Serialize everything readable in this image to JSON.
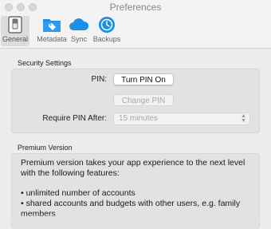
{
  "window": {
    "title": "Preferences"
  },
  "toolbar": {
    "items": [
      {
        "label": "General",
        "icon": "switch-icon"
      },
      {
        "label": "Metadata",
        "icon": "folder-tag-icon"
      },
      {
        "label": "Sync",
        "icon": "cloud-icon"
      },
      {
        "label": "Backups",
        "icon": "clock-backup-icon"
      }
    ]
  },
  "security": {
    "title": "Security Settings",
    "pin_label": "PIN:",
    "turn_pin_on": "Turn PIN On",
    "change_pin": "Change PIN",
    "require_label": "Require PIN After:",
    "require_value": "15 minutes"
  },
  "premium": {
    "title": "Premium Version",
    "intro": "Premium version takes your app experience to the next level with the following features:",
    "features": [
      "• unlimited number of accounts",
      "• shared accounts and budgets with other users, e.g. family members"
    ]
  },
  "colors": {
    "accent": "#1a8fe3",
    "panel": "#e2e2e2"
  }
}
